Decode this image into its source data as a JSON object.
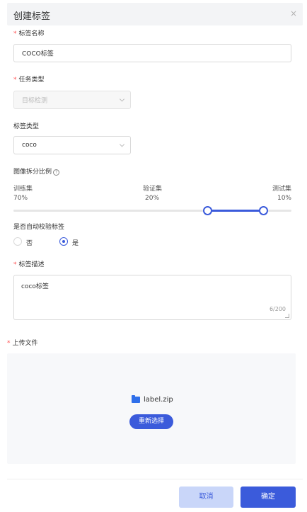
{
  "dialog": {
    "title": "创建标签",
    "close_glyph": "×"
  },
  "required_mark": "*",
  "fields": {
    "label_name": {
      "label": "标签名称",
      "value": "COCO标签"
    },
    "task_type": {
      "label": "任务类型",
      "value": "目标检测"
    },
    "label_type": {
      "label": "标签类型",
      "value": "coco"
    },
    "split": {
      "label": "图像拆分比例",
      "help_glyph": "?",
      "train": {
        "name": "训练集",
        "percent": "70%"
      },
      "val": {
        "name": "验证集",
        "percent": "20%"
      },
      "test": {
        "name": "测试集",
        "percent": "10%"
      },
      "handles": [
        0.7,
        0.9
      ]
    },
    "auto_check": {
      "label": "是否自动校验标签",
      "options": [
        "否",
        "是"
      ],
      "selected": "是"
    },
    "description": {
      "label": "标签描述",
      "value": "coco标签",
      "count": "6/200"
    },
    "upload": {
      "label": "上传文件",
      "file_name": "label.zip",
      "reselect_label": "重新选择"
    }
  },
  "footer": {
    "cancel_label": "取消",
    "ok_label": "确定"
  },
  "colors": {
    "accent": "#3b5bdb",
    "required": "#ff4d4f"
  },
  "icons": {
    "close": "close-icon",
    "chevron": "chevron-down-icon",
    "help": "help-circle-icon",
    "folder": "folder-icon",
    "resize": "resize-handle-icon"
  }
}
